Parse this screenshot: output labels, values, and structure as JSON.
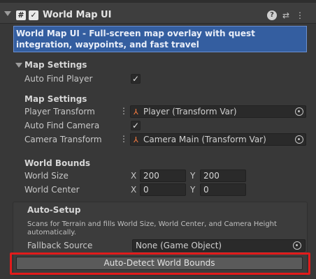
{
  "component": {
    "title": "World Map UI",
    "script_icon_glyph": "#",
    "enabled_glyph": "✓",
    "help_glyph": "?",
    "settings_glyph": "⇄",
    "menu_glyph": "⋮"
  },
  "description": "World Map UI - Full-screen map overlay with quest integration, waypoints, and fast travel",
  "map_settings": {
    "foldout_label": "Map Settings",
    "auto_find_player_label": "Auto Find Player",
    "auto_find_player_value": "✓",
    "subheader": "Map Settings",
    "player_transform_label": "Player Transform",
    "player_transform_value": "Player (Transform Var)",
    "auto_find_camera_label": "Auto Find Camera",
    "auto_find_camera_value": "✓",
    "camera_transform_label": "Camera Transform",
    "camera_transform_value": "Camera Main (Transform Var)"
  },
  "world_bounds": {
    "header": "World Bounds",
    "world_size_label": "World Size",
    "world_size_x": "200",
    "world_size_y": "200",
    "world_center_label": "World Center",
    "world_center_x": "0",
    "world_center_y": "0",
    "x_label": "X",
    "y_label": "Y"
  },
  "auto_setup": {
    "header": "Auto-Setup",
    "help_line1": "Scans for Terrain and fills World Size, World Center, and Camera Height",
    "help_line2": "automatically.",
    "fallback_label": "Fallback Source",
    "fallback_value": "None (Game Object)",
    "button_label": "Auto-Detect World Bounds"
  },
  "colors": {
    "background": "#383838",
    "description_bg": "#345ea0",
    "highlight": "#e11b1b"
  }
}
